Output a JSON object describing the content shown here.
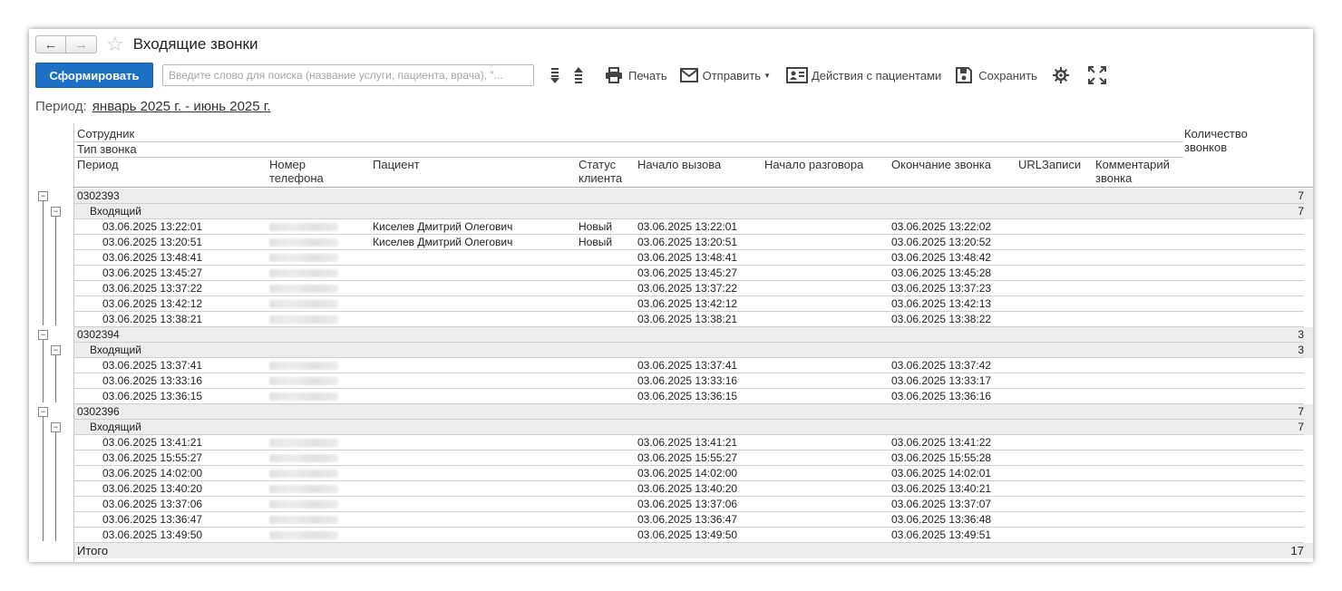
{
  "window": {
    "title": "Входящие звонки"
  },
  "nav": {
    "back": "←",
    "forward": "→",
    "star": "☆"
  },
  "toolbar": {
    "generate_label": "Сформировать",
    "search_placeholder": "Введите слово для поиска (название услуги, пациента, врача), \"...",
    "print_label": "Печать",
    "send_label": "Отправить",
    "patients_label": "Действия с пациентами",
    "save_label": "Сохранить"
  },
  "period": {
    "label": "Период:",
    "value": "январь 2025 г. - июнь 2025 г."
  },
  "headers": {
    "employee": "Сотрудник",
    "call_type": "Тип звонка",
    "period": "Период",
    "phone": "Номер телефона",
    "patient": "Пациент",
    "status": "Статус клиента",
    "call_start": "Начало вызова",
    "talk_start": "Начало разговора",
    "call_end": "Окончание звонка",
    "url": "URLЗаписи",
    "comment": "Комментарий звонка",
    "count": "Количество звонков"
  },
  "groups": [
    {
      "employee": "0302393",
      "count": "7",
      "type": "Входящий",
      "type_count": "7",
      "rows": [
        {
          "period": "03.06.2025 13:22:01",
          "patient": "Киселев Дмитрий Олегович",
          "status": "Новый",
          "start": "03.06.2025 13:22:01",
          "end": "03.06.2025 13:22:02"
        },
        {
          "period": "03.06.2025 13:20:51",
          "patient": "Киселев Дмитрий Олегович",
          "status": "Новый",
          "start": "03.06.2025 13:20:51",
          "end": "03.06.2025 13:20:52"
        },
        {
          "period": "03.06.2025 13:48:41",
          "patient": "",
          "status": "",
          "start": "03.06.2025 13:48:41",
          "end": "03.06.2025 13:48:42"
        },
        {
          "period": "03.06.2025 13:45:27",
          "patient": "",
          "status": "",
          "start": "03.06.2025 13:45:27",
          "end": "03.06.2025 13:45:28"
        },
        {
          "period": "03.06.2025 13:37:22",
          "patient": "",
          "status": "",
          "start": "03.06.2025 13:37:22",
          "end": "03.06.2025 13:37:23"
        },
        {
          "period": "03.06.2025 13:42:12",
          "patient": "",
          "status": "",
          "start": "03.06.2025 13:42:12",
          "end": "03.06.2025 13:42:13"
        },
        {
          "period": "03.06.2025 13:38:21",
          "patient": "",
          "status": "",
          "start": "03.06.2025 13:38:21",
          "end": "03.06.2025 13:38:22"
        }
      ]
    },
    {
      "employee": "0302394",
      "count": "3",
      "type": "Входящий",
      "type_count": "3",
      "rows": [
        {
          "period": "03.06.2025 13:37:41",
          "patient": "",
          "status": "",
          "start": "03.06.2025 13:37:41",
          "end": "03.06.2025 13:37:42"
        },
        {
          "period": "03.06.2025 13:33:16",
          "patient": "",
          "status": "",
          "start": "03.06.2025 13:33:16",
          "end": "03.06.2025 13:33:17"
        },
        {
          "period": "03.06.2025 13:36:15",
          "patient": "",
          "status": "",
          "start": "03.06.2025 13:36:15",
          "end": "03.06.2025 13:36:16"
        }
      ]
    },
    {
      "employee": "0302396",
      "count": "7",
      "type": "Входящий",
      "type_count": "7",
      "rows": [
        {
          "period": "03.06.2025 13:41:21",
          "patient": "",
          "status": "",
          "start": "03.06.2025 13:41:21",
          "end": "03.06.2025 13:41:22"
        },
        {
          "period": "03.06.2025 15:55:27",
          "patient": "",
          "status": "",
          "start": "03.06.2025 15:55:27",
          "end": "03.06.2025 15:55:28"
        },
        {
          "period": "03.06.2025 14:02:00",
          "patient": "",
          "status": "",
          "start": "03.06.2025 14:02:00",
          "end": "03.06.2025 14:02:01"
        },
        {
          "period": "03.06.2025 13:40:20",
          "patient": "",
          "status": "",
          "start": "03.06.2025 13:40:20",
          "end": "03.06.2025 13:40:21"
        },
        {
          "period": "03.06.2025 13:37:06",
          "patient": "",
          "status": "",
          "start": "03.06.2025 13:37:06",
          "end": "03.06.2025 13:37:07"
        },
        {
          "period": "03.06.2025 13:36:47",
          "patient": "",
          "status": "",
          "start": "03.06.2025 13:36:47",
          "end": "03.06.2025 13:36:48"
        },
        {
          "period": "03.06.2025 13:49:50",
          "patient": "",
          "status": "",
          "start": "03.06.2025 13:49:50",
          "end": "03.06.2025 13:49:51"
        }
      ]
    }
  ],
  "total": {
    "label": "Итого",
    "value": "17"
  }
}
